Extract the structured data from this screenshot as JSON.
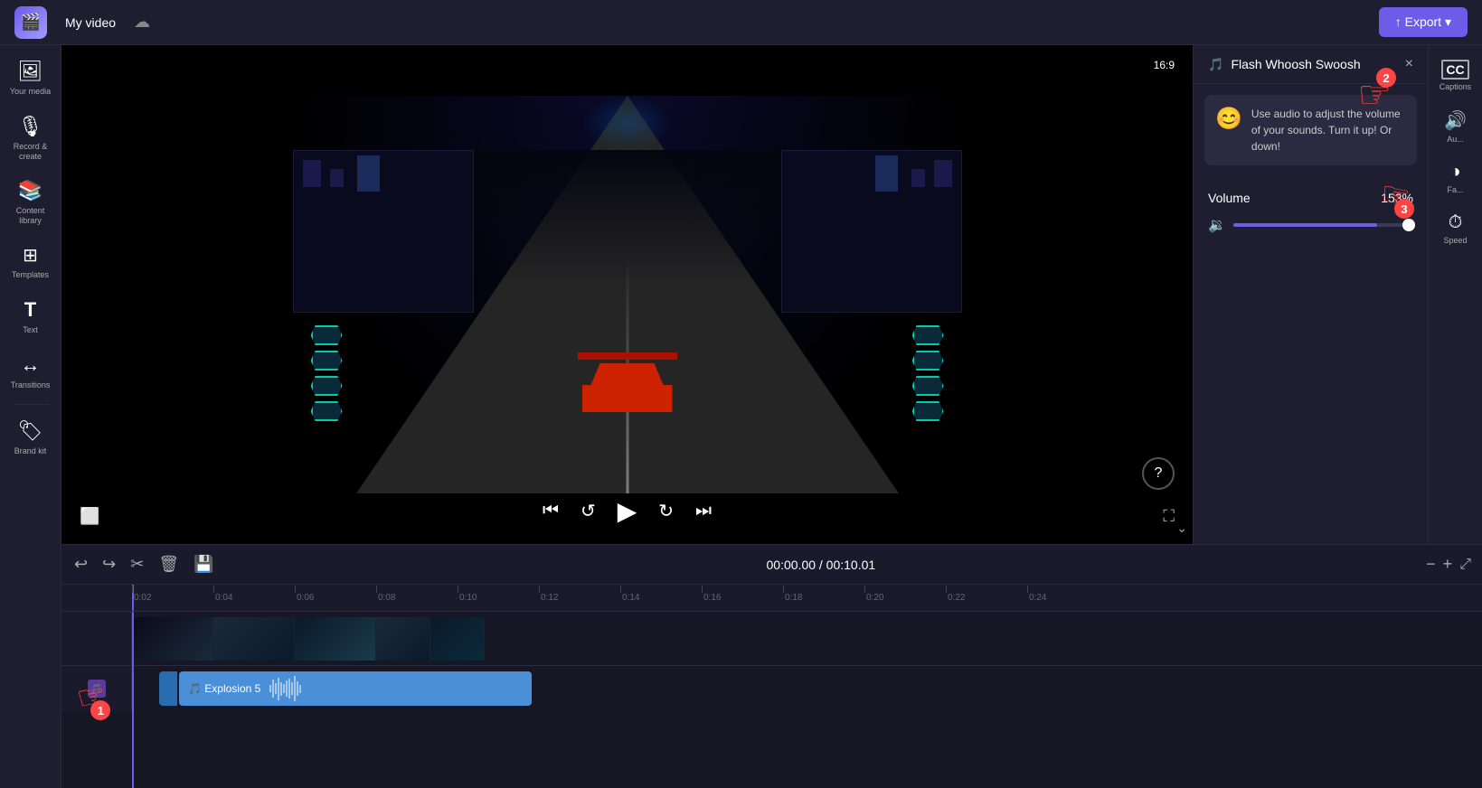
{
  "app": {
    "logo": "🎬",
    "project_name": "My video",
    "export_label": "↑ Export ▾"
  },
  "sidebar": {
    "items": [
      {
        "id": "your-media",
        "icon": "🖼",
        "label": "Your media"
      },
      {
        "id": "record-create",
        "icon": "🎙",
        "label": "Record &\ncreate"
      },
      {
        "id": "content-library",
        "icon": "📚",
        "label": "Content\nlibrary"
      },
      {
        "id": "templates",
        "icon": "⊞",
        "label": "Templates"
      },
      {
        "id": "text",
        "icon": "T",
        "label": "Text"
      },
      {
        "id": "transitions",
        "icon": "↔",
        "label": "Transitions"
      },
      {
        "id": "brand-kit",
        "icon": "🏷",
        "label": "Brand kit"
      }
    ]
  },
  "preview": {
    "aspect_ratio": "16:9",
    "time_current": "00:00.00",
    "time_total": "00:10.01"
  },
  "right_panel": {
    "title": "Flash Whoosh Swoosh",
    "close_btn": "×",
    "tooltip": {
      "emoji": "😊",
      "text": "Use audio to adjust the volume of your sounds. Turn it up! Or down!"
    },
    "volume": {
      "label": "Volume",
      "value": "153%",
      "fill_percent": 80
    }
  },
  "right_sidebar": {
    "items": [
      {
        "id": "captions",
        "icon": "CC",
        "label": "Captions"
      },
      {
        "id": "audio",
        "icon": "🔊",
        "label": "Au..."
      },
      {
        "id": "fade",
        "icon": "◑",
        "label": "Fa..."
      },
      {
        "id": "speed",
        "icon": "⏱",
        "label": "Speed"
      }
    ]
  },
  "timeline": {
    "toolbar": {
      "undo": "↩",
      "redo": "↪",
      "cut": "✂",
      "delete": "🗑",
      "save": "💾",
      "time": "00:00.00 / 00:10.01",
      "zoom_out": "−",
      "zoom_in": "+",
      "fit": "⤢"
    },
    "ruler_marks": [
      "0:02",
      "0:04",
      "0:06",
      "0:08",
      "0:10",
      "0:12",
      "0:14",
      "0:16",
      "0:18",
      "0:20",
      "0:22",
      "0:24"
    ],
    "audio_clip_label": "🎵 Explosion 5"
  },
  "annotations": [
    {
      "step": 1,
      "label": "1"
    },
    {
      "step": 2,
      "label": "2"
    },
    {
      "step": 3,
      "label": "3"
    }
  ]
}
